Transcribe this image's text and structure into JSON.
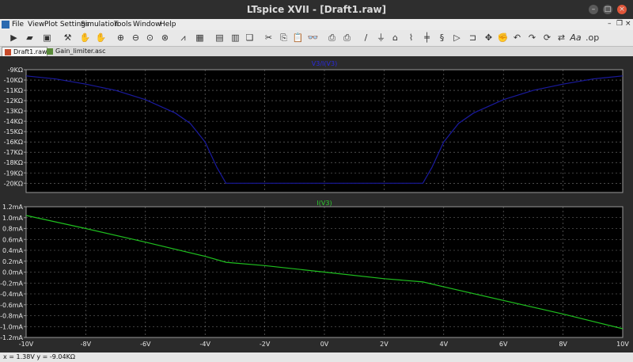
{
  "window": {
    "title": "LTspice XVII - [Draft1.raw]"
  },
  "menu": [
    "File",
    "View",
    "Plot Settings",
    "Simulation",
    "Tools",
    "Window",
    "Help"
  ],
  "toolbar_icons": [
    "run-icon",
    "open-icon",
    "save-icon",
    "control-panel-icon",
    "halt-icon",
    "pan-icon",
    "zoom-in-icon",
    "zoom-out-icon",
    "zoom-fit-icon",
    "zoom-cancel-icon",
    "autorange-icon",
    "pick-traces-icon",
    "tile-horizontal-icon",
    "tile-vertical-icon",
    "cascade-icon",
    "cut-icon",
    "copy-icon",
    "paste-icon",
    "find-icon",
    "print-setup-icon",
    "print-icon",
    "wire-icon",
    "ground-icon",
    "label-icon",
    "resistor-icon",
    "capacitor-icon",
    "inductor-icon",
    "diode-icon",
    "component-icon",
    "move-icon",
    "undo-icon",
    "redo-icon",
    "rotate-icon",
    "mirror-icon",
    "text-icon",
    "spice-directive-icon"
  ],
  "tabs": [
    {
      "label": "Draft1.raw",
      "active": true
    },
    {
      "label": "Gain_limiter.asc",
      "active": false
    }
  ],
  "status": {
    "text": "x = 1.38V    y = -9.04KΩ"
  },
  "colors": {
    "trace_top": "#1a1a9e",
    "trace_bottom": "#1fbf1f",
    "plot_bg": "#000000",
    "grid": "#7a7a7a",
    "title_top": "#2a2adf",
    "title_bottom": "#2ecc2e"
  },
  "chart_data": [
    {
      "type": "line",
      "title": "V3/I(V3)",
      "x_ticks": [
        "-10V",
        "-8V",
        "-6V",
        "-4V",
        "-2V",
        "0V",
        "2V",
        "4V",
        "6V",
        "8V",
        "10V"
      ],
      "y_ticks": [
        "-9KΩ",
        "-10KΩ",
        "-11KΩ",
        "-12KΩ",
        "-13KΩ",
        "-14KΩ",
        "-15KΩ",
        "-16KΩ",
        "-17KΩ",
        "-18KΩ",
        "-19KΩ",
        "-20KΩ"
      ],
      "xlim": [
        -10,
        10
      ],
      "ylim": [
        -20.9,
        -9
      ],
      "series": [
        {
          "x": [
            -10,
            -9,
            -8,
            -7,
            -6,
            -5,
            -4.5,
            -4,
            -3.6,
            -3.3,
            3.3,
            3.6,
            4,
            4.5,
            5,
            6,
            7,
            8,
            9,
            10
          ],
          "y": [
            -9.6,
            -9.9,
            -10.4,
            -11.0,
            -11.9,
            -13.2,
            -14.2,
            -16.0,
            -18.5,
            -20.0,
            -20.0,
            -18.5,
            -16.0,
            -14.2,
            -13.2,
            -11.9,
            -11.0,
            -10.4,
            -9.9,
            -9.6
          ]
        }
      ]
    },
    {
      "type": "line",
      "title": "I(V3)",
      "x_ticks": [
        "-10V",
        "-8V",
        "-6V",
        "-4V",
        "-2V",
        "0V",
        "2V",
        "4V",
        "6V",
        "8V",
        "10V"
      ],
      "y_ticks": [
        "1.2mA",
        "1.0mA",
        "0.8mA",
        "0.6mA",
        "0.4mA",
        "0.2mA",
        "0.0mA",
        "-0.2mA",
        "-0.4mA",
        "-0.6mA",
        "-0.8mA",
        "-1.0mA",
        "-1.2mA"
      ],
      "xlim": [
        -10,
        10
      ],
      "ylim": [
        -1.2,
        1.2
      ],
      "series": [
        {
          "x": [
            -10,
            -8,
            -6,
            -4,
            -3.3,
            -2,
            0,
            2,
            3.3,
            4,
            6,
            8,
            10
          ],
          "y": [
            1.04,
            0.8,
            0.55,
            0.29,
            0.18,
            0.12,
            0,
            -0.12,
            -0.18,
            -0.27,
            -0.52,
            -0.77,
            -1.04
          ]
        }
      ]
    }
  ]
}
